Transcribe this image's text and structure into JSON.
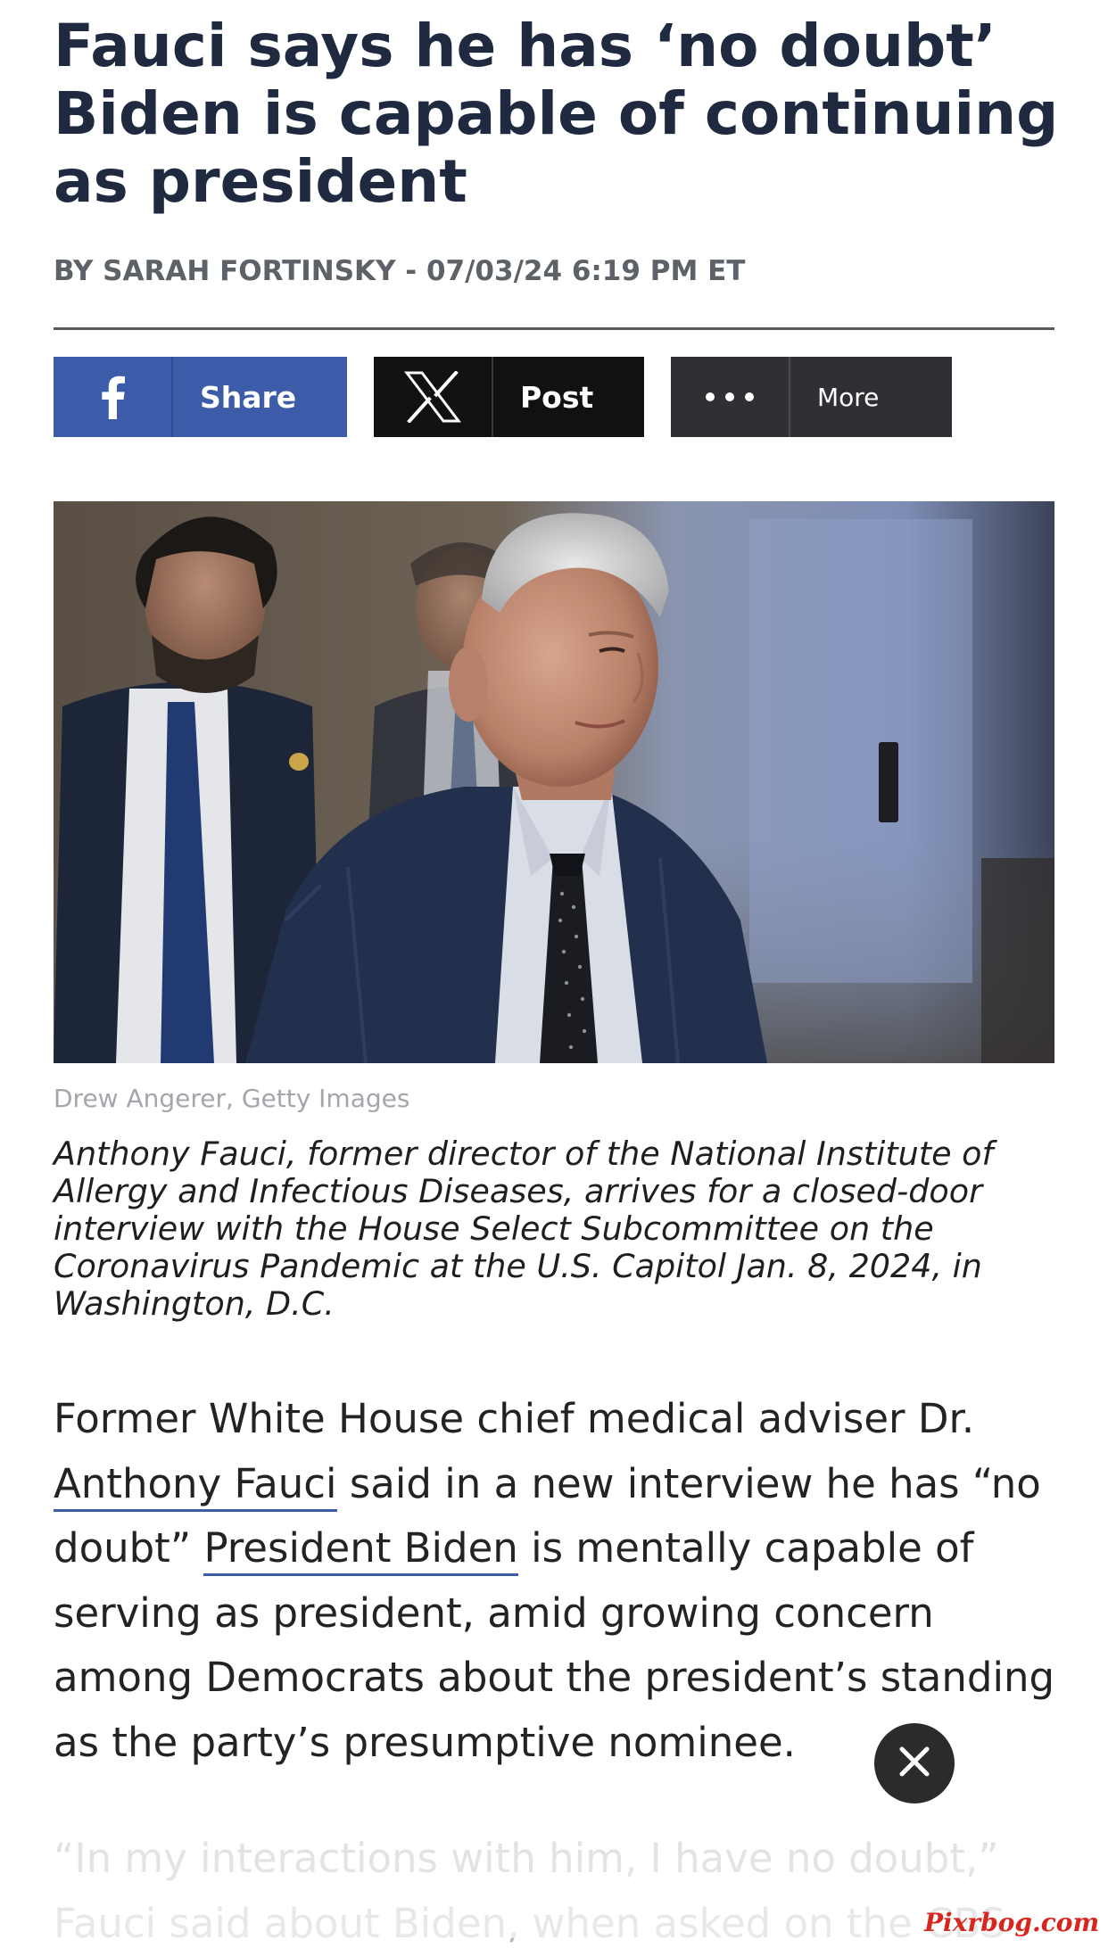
{
  "article": {
    "headline": "Fauci says he has ‘no doubt’ Biden is capable of continuing as president",
    "byline": "BY SARAH FORTINSKY - 07/03/24 6:19 PM ET"
  },
  "share_bar": {
    "facebook_label": "Share",
    "x_label": "Post",
    "more_label": "More",
    "facebook_color": "#3c5ba8",
    "x_color": "#111111",
    "more_color": "#2f3033"
  },
  "photo": {
    "credit": "Drew Angerer, Getty Images",
    "caption": "Anthony Fauci, former director of the National Institute of Allergy and Infectious Diseases, arrives for a closed-door interview with the House Select Subcommittee on the Coronavirus Pandemic at the U.S. Capitol Jan. 8, 2024, in Washington, D.C."
  },
  "body": {
    "p1_start": "Former White House chief medical adviser Dr. ",
    "link_fauci": "Anthony Fauci",
    "p1_mid": " said in a new interview he has “no doubt” ",
    "link_biden": "President Biden",
    "p1_end": " is mentally capable of serving as president, amid growing concern among Democrats about the president’s standing as the party’s presumptive nominee.",
    "p2_line1": "“In my interactions with him, I have no doubt,”",
    "p2_line2": "Fauci said about Biden, when asked on the CBS"
  },
  "link_color": "#3b5ca8",
  "watermark": "Pixrbog.com"
}
